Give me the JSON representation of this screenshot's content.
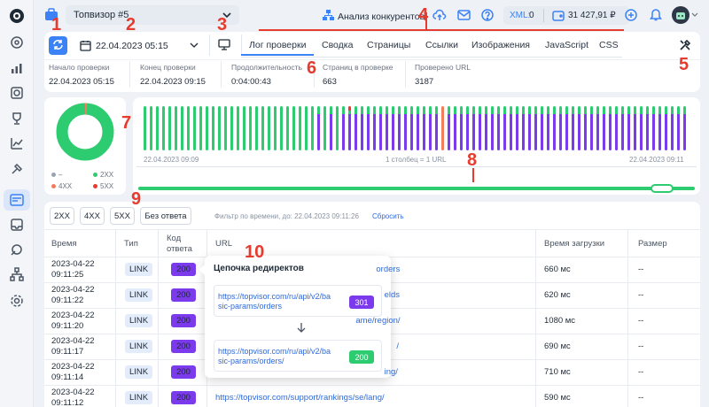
{
  "colors": {
    "accent": "#3b82f6",
    "success": "#2ecc71",
    "purple": "#7c3aed",
    "orange": "#f47c5a",
    "red": "#e63b2e"
  },
  "header": {
    "project": "Топвизор #5",
    "competitors": "Анализ конкурентов",
    "xml_label": "XML:",
    "xml_value": "0",
    "balance": "31 427,91 ₽"
  },
  "toolbar": {
    "date": "22.04.2023 05:15",
    "tabs": [
      "Лог проверки",
      "Сводка",
      "Страницы",
      "Ссылки",
      "Изображения",
      "JavaScript",
      "CSS"
    ],
    "active_tab": "Лог проверки"
  },
  "stats": [
    {
      "label": "Начало проверки",
      "value": "22.04.2023 05:15"
    },
    {
      "label": "Конец проверки",
      "value": "22.04.2023 09:15"
    },
    {
      "label": "Продолжительность",
      "value": "0:04:00:43"
    },
    {
      "label": "Страниц в проверке",
      "value": "663"
    },
    {
      "label": "Проверено URL",
      "value": "3187"
    }
  ],
  "legend": [
    {
      "label": "–",
      "color": "#9aa3b2"
    },
    {
      "label": "2XX",
      "color": "#2ecc71"
    },
    {
      "label": "4XX",
      "color": "#f47c5a"
    },
    {
      "label": "5XX",
      "color": "#e63b2e"
    }
  ],
  "timeline": {
    "start": "22.04.2023 09:09",
    "end": "22.04.2023 09:11",
    "note": "1 столбец = 1 URL"
  },
  "filters": {
    "buttons": [
      "2XX",
      "4XX",
      "5XX",
      "Без ответа"
    ],
    "time_filter": "Фильтр по времени, до: 22.04.2023 09:11:26",
    "reset": "Сбросить"
  },
  "table": {
    "headers": [
      "Время",
      "Тип",
      "Код ответа",
      "URL",
      "Время загрузки",
      "Размер"
    ],
    "rows": [
      {
        "date": "2023-04-22",
        "time": "09:11:25",
        "type": "LINK",
        "code": "200",
        "url": "orders",
        "load": "660 мс",
        "size": "--"
      },
      {
        "date": "2023-04-22",
        "time": "09:11:22",
        "type": "LINK",
        "code": "200",
        "url": "elds",
        "load": "620 мс",
        "size": "--"
      },
      {
        "date": "2023-04-22",
        "time": "09:11:20",
        "type": "LINK",
        "code": "200",
        "url": "ame/region/",
        "load": "1080 мс",
        "size": "--"
      },
      {
        "date": "2023-04-22",
        "time": "09:11:17",
        "type": "LINK",
        "code": "200",
        "url": "/",
        "load": "690 мс",
        "size": "--"
      },
      {
        "date": "2023-04-22",
        "time": "09:11:14",
        "type": "LINK",
        "code": "200",
        "url": "ing/",
        "load": "710 мс",
        "size": "--"
      },
      {
        "date": "2023-04-22",
        "time": "09:11:12",
        "type": "LINK",
        "code": "200",
        "url": "https://topvisor.com/support/rankings/se/lang/",
        "load": "590 мс",
        "size": "--"
      }
    ]
  },
  "popup": {
    "title": "Цепочка редиректов",
    "items": [
      {
        "url": "https://topvisor.com/ru/api/v2/basic-params/orders",
        "code": "301"
      },
      {
        "url": "https://topvisor.com/ru/api/v2/basic-params/orders/",
        "code": "200"
      }
    ]
  },
  "markers": [
    "1",
    "2",
    "3",
    "4",
    "5",
    "6",
    "7",
    "8",
    "9",
    "10"
  ]
}
